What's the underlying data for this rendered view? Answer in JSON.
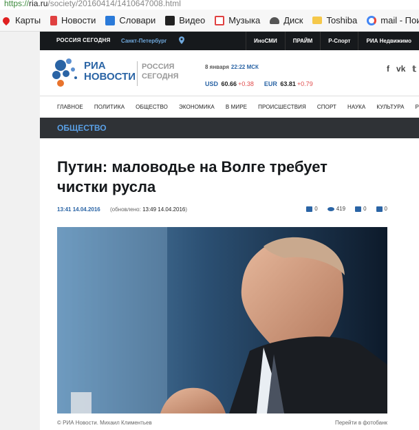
{
  "browser": {
    "url_scheme": "https://",
    "url_host": "ria.ru",
    "url_path": "/society/20160414/1410647008.html",
    "bookmarks": [
      {
        "label": "Карты",
        "icon": "map-pin-icon",
        "color": "#e02020"
      },
      {
        "label": "Новости",
        "icon": "news-icon",
        "color": "#e04040"
      },
      {
        "label": "Словари",
        "icon": "dictionary-icon",
        "color": "#2a7ad9"
      },
      {
        "label": "Видео",
        "icon": "video-icon",
        "color": "#222222"
      },
      {
        "label": "Музыка",
        "icon": "music-icon",
        "color": "#e04040"
      },
      {
        "label": "Диск",
        "icon": "disk-icon",
        "color": "#555555"
      },
      {
        "label": "Toshiba",
        "icon": "folder-icon",
        "color": "#f5c84a"
      },
      {
        "label": "mail - Поиск в",
        "icon": "google-icon",
        "color": "#4285f4"
      }
    ]
  },
  "topbar": {
    "logo": "РОССИЯ СЕГОДНЯ",
    "city": "Санкт-Петербург",
    "links": [
      "ИноСМИ",
      "ПРАЙМ",
      "Р-Спорт",
      "РИА Недвижимо"
    ]
  },
  "header": {
    "brand_line1": "РИА",
    "brand_line2": "НОВОСТИ",
    "brand_sub1": "РОССИЯ",
    "brand_sub2": "СЕГОДНЯ",
    "date": "8 января",
    "time": "22:22 МСК",
    "rates": [
      {
        "code": "USD",
        "value": "60.66",
        "change": "+0.38"
      },
      {
        "code": "EUR",
        "value": "63.81",
        "change": "+0.79"
      }
    ],
    "social": [
      "f",
      "vk",
      "tw"
    ]
  },
  "nav": [
    "ГЛАВНОЕ",
    "ПОЛИТИКА",
    "ОБЩЕСТВО",
    "ЭКОНОМИКА",
    "В МИРЕ",
    "ПРОИСШЕСТВИЯ",
    "СПОРТ",
    "НАУКА",
    "КУЛЬТУРА",
    "Р"
  ],
  "section": "ОБЩЕСТВО",
  "article": {
    "title": "Путин: маловодье на Волге требует чистки русла",
    "time": "13:41",
    "date": "14.04.2016",
    "updated_label": "(обновлено:",
    "updated_value": "13:49 14.04.2016",
    "updated_close": ")",
    "counters": {
      "comments": "0",
      "views": "419",
      "likes": "0",
      "dislikes": "0"
    },
    "caption": "© РИА Новости. Михаил Климентьев",
    "photobank_link": "Перейти в фотобанк"
  },
  "colors": {
    "accent": "#2a64a5",
    "topbar": "#16191c",
    "section": "#2f3236",
    "section_text": "#5aa0e6",
    "rate_change": "#e04a4a"
  }
}
